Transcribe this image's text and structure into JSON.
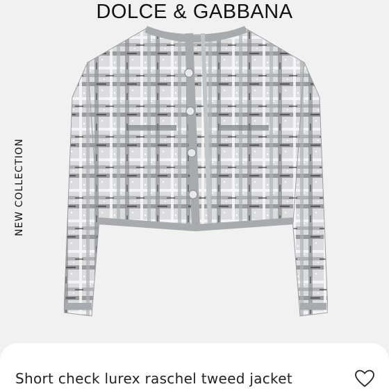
{
  "brand": {
    "name": "DOLCE & GABBANA"
  },
  "side_label": "NEW COLLECTION",
  "product": {
    "image_icon": "jacket-image",
    "title": "Short check lurex raschel tweed jacket",
    "wishlist_icon": "heart-outline-icon"
  }
}
